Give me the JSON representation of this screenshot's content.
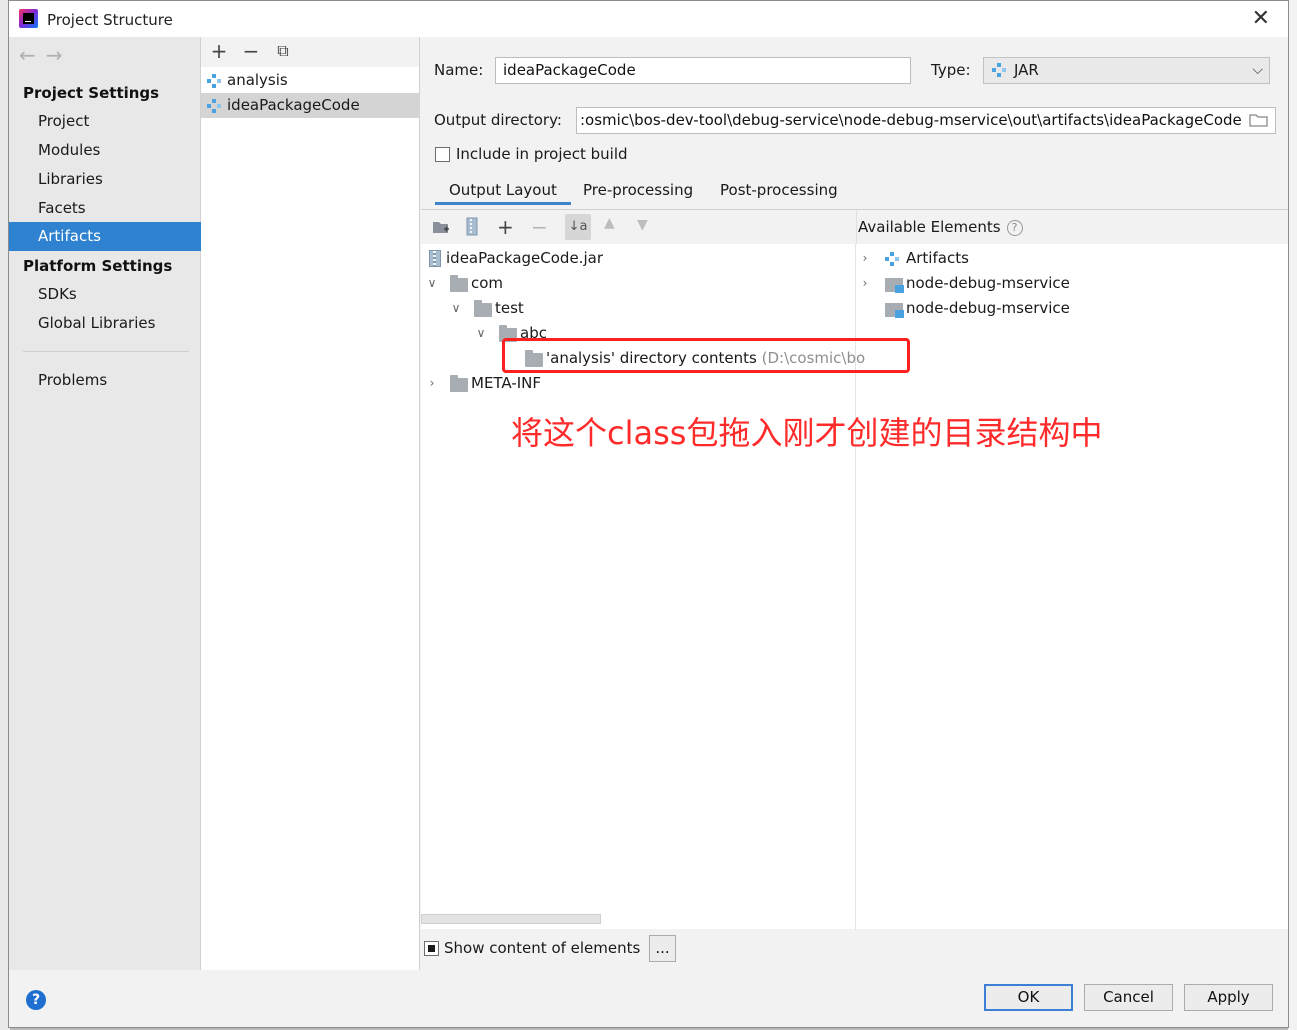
{
  "window": {
    "title": "Project Structure",
    "close": "✕"
  },
  "nav": {
    "back": "←",
    "forward": "→"
  },
  "sidebar": {
    "project_settings": "Project Settings",
    "items": [
      {
        "label": "Project"
      },
      {
        "label": "Modules"
      },
      {
        "label": "Libraries"
      },
      {
        "label": "Facets"
      },
      {
        "label": "Artifacts",
        "selected": true
      }
    ],
    "platform_settings": "Platform Settings",
    "platform_items": [
      {
        "label": "SDKs"
      },
      {
        "label": "Global Libraries"
      }
    ],
    "problems": "Problems"
  },
  "artifact_list": {
    "toolbar": {
      "add": "+",
      "remove": "−",
      "copy": "⧉"
    },
    "items": [
      {
        "label": "analysis"
      },
      {
        "label": "ideaPackageCode",
        "selected": true
      }
    ]
  },
  "form": {
    "name_label": "Name:",
    "name_value": "ideaPackageCode",
    "type_label": "Type:",
    "type_value": "JAR",
    "output_label": "Output directory:",
    "output_value": ":osmic\\bos-dev-tool\\debug-service\\node-debug-mservice\\out\\artifacts\\ideaPackageCode",
    "include_label": "Include in project build",
    "include_checked": false
  },
  "tabs": [
    {
      "label": "Output Layout",
      "active": true
    },
    {
      "label": "Pre-processing"
    },
    {
      "label": "Post-processing"
    }
  ],
  "layout_tree": [
    {
      "label": "ideaPackageCode.jar"
    },
    {
      "label": "com"
    },
    {
      "label": "test"
    },
    {
      "label": "abc"
    },
    {
      "label": "'analysis' directory contents",
      "hint": "(D:\\cosmic\\bo"
    },
    {
      "label": "META-INF"
    }
  ],
  "available": {
    "header": "Available Elements",
    "items": [
      {
        "label": "Artifacts"
      },
      {
        "label": "node-debug-mservice"
      },
      {
        "label": "node-debug-mservice"
      }
    ]
  },
  "annotation": "将这个class包拖入刚才创建的目录结构中",
  "bottom": {
    "show_content_label": "Show content of elements",
    "show_content_checked": true,
    "more_button": "...",
    "ok": "OK",
    "cancel": "Cancel",
    "apply": "Apply"
  },
  "colors": {
    "selection": "#2f82cf",
    "annotation_red": "#ff2020",
    "tab_underline": "#4083c9",
    "help_blue": "#1f6fd0"
  }
}
